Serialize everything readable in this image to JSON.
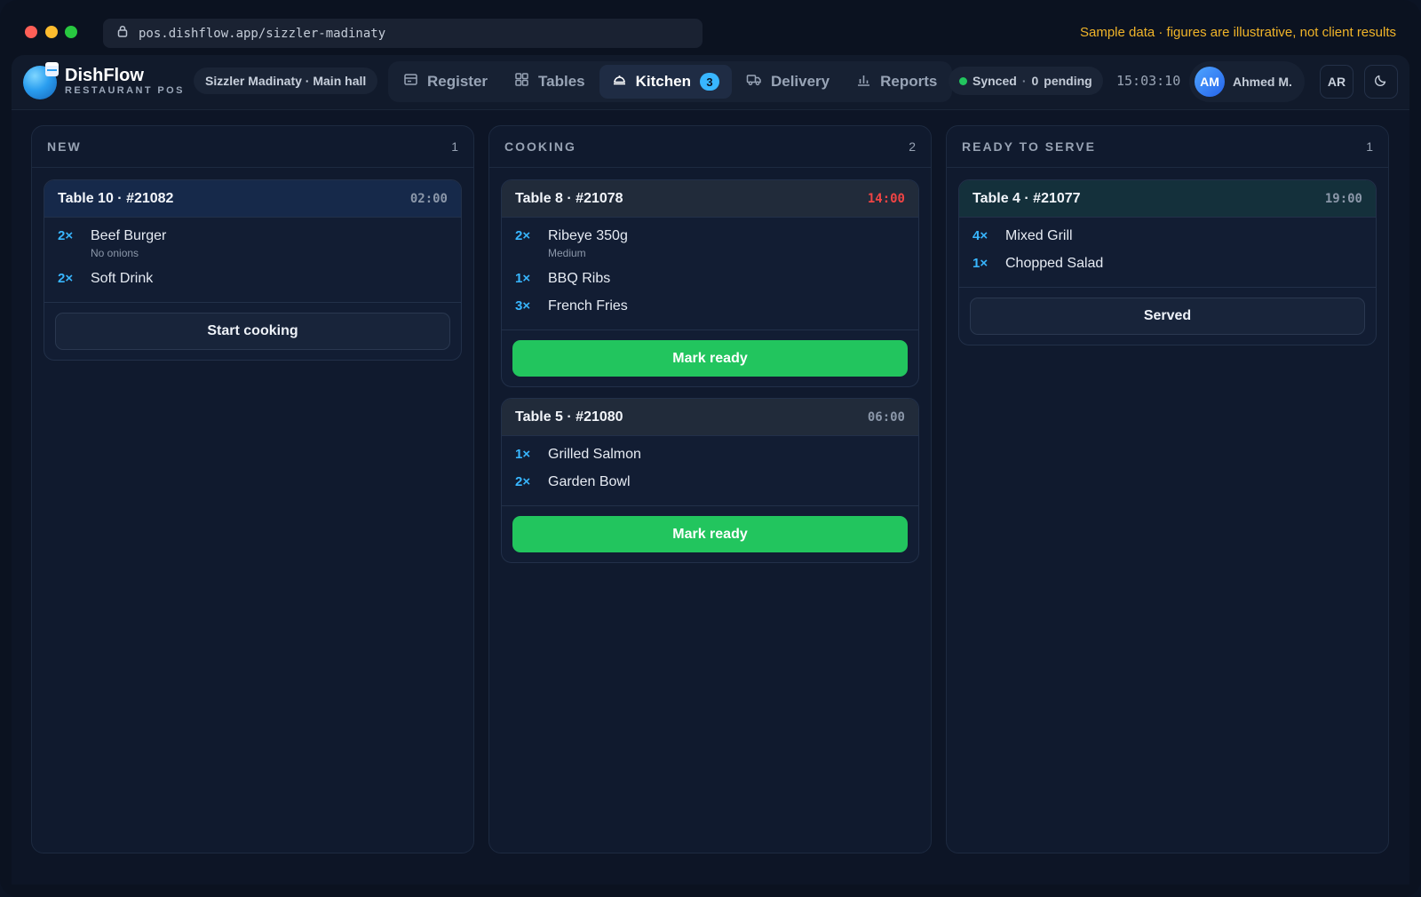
{
  "window": {
    "url": "pos.dishflow.app/sizzler-madinaty",
    "sample_note": "Sample data · figures are illustrative, not client results"
  },
  "header": {
    "brand_name": "DishFlow",
    "brand_sub": "RESTAURANT POS",
    "location": "Sizzler Madinaty · Main hall",
    "nav": [
      {
        "label": "Register",
        "icon": "register-icon"
      },
      {
        "label": "Tables",
        "icon": "tables-icon"
      },
      {
        "label": "Kitchen",
        "icon": "kitchen-icon",
        "badge": "3",
        "active": true
      },
      {
        "label": "Delivery",
        "icon": "delivery-icon"
      },
      {
        "label": "Reports",
        "icon": "reports-icon"
      }
    ],
    "sync_status": "Synced",
    "sync_sep": "·",
    "pending_count": "0",
    "pending_label": "pending",
    "clock": "15:03:10",
    "user_initials": "AM",
    "user_name": "Ahmed M.",
    "language": "AR"
  },
  "colors": {
    "accent": "#38b6ff",
    "success": "#22c55e",
    "danger": "#ef4444",
    "warning": "#f0b429"
  },
  "columns": {
    "new": {
      "title": "NEW",
      "count": "1",
      "cards": [
        {
          "title": "Table 10 · #21082",
          "timer": "02:00",
          "items": [
            {
              "qty": "2×",
              "name": "Beef Burger",
              "note": "No onions"
            },
            {
              "qty": "2×",
              "name": "Soft Drink"
            }
          ],
          "action": "Start cooking"
        }
      ]
    },
    "cooking": {
      "title": "COOKING",
      "count": "2",
      "cards": [
        {
          "title": "Table 8 · #21078",
          "timer": "14:00",
          "items": [
            {
              "qty": "2×",
              "name": "Ribeye 350g",
              "note": "Medium"
            },
            {
              "qty": "1×",
              "name": "BBQ Ribs"
            },
            {
              "qty": "3×",
              "name": "French Fries"
            }
          ],
          "action": "Mark ready"
        },
        {
          "title": "Table 5 · #21080",
          "timer": "06:00",
          "items": [
            {
              "qty": "1×",
              "name": "Grilled Salmon"
            },
            {
              "qty": "2×",
              "name": "Garden Bowl"
            }
          ],
          "action": "Mark ready"
        }
      ]
    },
    "ready": {
      "title": "READY TO SERVE",
      "count": "1",
      "cards": [
        {
          "title": "Table 4 · #21077",
          "timer": "19:00",
          "items": [
            {
              "qty": "4×",
              "name": "Mixed Grill"
            },
            {
              "qty": "1×",
              "name": "Chopped Salad"
            }
          ],
          "action": "Served"
        }
      ]
    }
  }
}
